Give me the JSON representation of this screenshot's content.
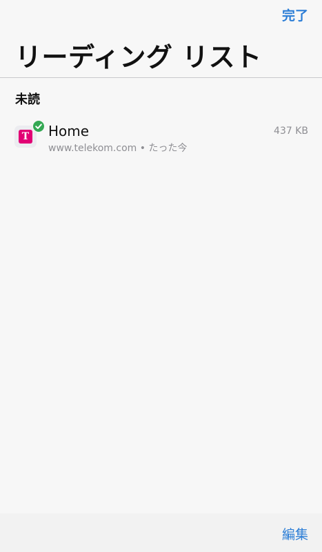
{
  "header": {
    "done_label": "完了",
    "title": "リーディング リスト"
  },
  "sections": [
    {
      "title": "未読",
      "items": [
        {
          "title": "Home",
          "url": "www.telekom.com",
          "separator": "•",
          "time": "たった今",
          "size": "437 KB",
          "favicon_letter": "T",
          "favicon_color": "#e20074",
          "badge_icon": "check-icon"
        }
      ]
    }
  ],
  "footer": {
    "edit_label": "編集"
  },
  "colors": {
    "accent": "#2b7dd6",
    "badge": "#34a853",
    "secondary_text": "#8e8e93"
  }
}
